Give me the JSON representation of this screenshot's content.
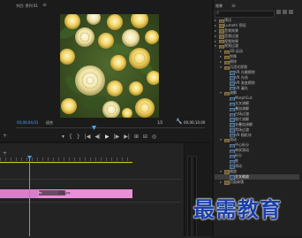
{
  "program_monitor": {
    "tab_label": "节目: 序列 01",
    "menu_icon": "hamburger-icon",
    "current_timecode": "00;00;04;01",
    "fit_label": "适合",
    "resolution_label": "1/2",
    "duration_timecode": "00;00;10;00",
    "transport": [
      "▾",
      "{",
      "}",
      "|◀",
      "◀|",
      "▶",
      "|▶",
      "▶|",
      "⊞",
      "⊟",
      "◎"
    ]
  },
  "effects_panel": {
    "title": "效果",
    "tree": [
      {
        "label": "预设",
        "depth": 0,
        "expanded": false,
        "icon": "folder"
      },
      {
        "label": "Lumetri 预设",
        "depth": 0,
        "expanded": false,
        "icon": "folder"
      },
      {
        "label": "音频效果",
        "depth": 0,
        "expanded": false,
        "icon": "folder"
      },
      {
        "label": "音频过渡",
        "depth": 0,
        "expanded": false,
        "icon": "folder"
      },
      {
        "label": "视频效果",
        "depth": 0,
        "expanded": false,
        "icon": "folder"
      },
      {
        "label": "视频过渡",
        "depth": 0,
        "expanded": true,
        "icon": "folder"
      },
      {
        "label": "3D 运动",
        "depth": 1,
        "expanded": false,
        "icon": "folder"
      },
      {
        "label": "划像",
        "depth": 1,
        "expanded": false,
        "icon": "folder"
      },
      {
        "label": "擦除",
        "depth": 1,
        "expanded": false,
        "icon": "folder"
      },
      {
        "label": "沉浸式视频",
        "depth": 1,
        "expanded": true,
        "icon": "folder"
      },
      {
        "label": "VR 光圈擦除",
        "depth": 2,
        "icon": "fx"
      },
      {
        "label": "VR 光线",
        "depth": 2,
        "icon": "fx"
      },
      {
        "label": "VR 渐变擦除",
        "depth": 2,
        "icon": "fx"
      },
      {
        "label": "VR 漏光",
        "depth": 2,
        "icon": "fx"
      },
      {
        "label": "溶解",
        "depth": 1,
        "expanded": true,
        "icon": "folder"
      },
      {
        "label": "MorphCut",
        "depth": 2,
        "icon": "fx"
      },
      {
        "label": "交叉溶解",
        "depth": 2,
        "icon": "fx"
      },
      {
        "label": "叠加溶解",
        "depth": 2,
        "icon": "fx"
      },
      {
        "label": "白场过渡",
        "depth": 2,
        "icon": "fx"
      },
      {
        "label": "胶片溶解",
        "depth": 2,
        "icon": "fx"
      },
      {
        "label": "非叠加溶解",
        "depth": 2,
        "icon": "fx"
      },
      {
        "label": "黑场过渡",
        "depth": 2,
        "icon": "fx"
      },
      {
        "label": "VR 随机块",
        "depth": 2,
        "icon": "fx"
      },
      {
        "label": "滑动",
        "depth": 1,
        "expanded": true,
        "icon": "folder"
      },
      {
        "label": "中心拆分",
        "depth": 2,
        "icon": "fx"
      },
      {
        "label": "带状滑动",
        "depth": 2,
        "icon": "fx"
      },
      {
        "label": "拆分",
        "depth": 2,
        "icon": "fx"
      },
      {
        "label": "推",
        "depth": 2,
        "icon": "fx"
      },
      {
        "label": "滑动",
        "depth": 2,
        "icon": "fx"
      },
      {
        "label": "缩放",
        "depth": 1,
        "expanded": true,
        "icon": "folder"
      },
      {
        "label": "交叉缩放",
        "depth": 2,
        "icon": "fx",
        "selected": true
      },
      {
        "label": "页面剥落",
        "depth": 1,
        "expanded": false,
        "icon": "folder"
      }
    ]
  },
  "timeline": {
    "clip_label": "fx",
    "clip_name": "花朵.jpg"
  },
  "watermark": "最需教育",
  "colors": {
    "accent_blue": "#4aa3ff",
    "work_area_yellow": "#d3c41d",
    "clip_pink": "#e88fd8",
    "watermark_blue": "#1b3fa8"
  }
}
